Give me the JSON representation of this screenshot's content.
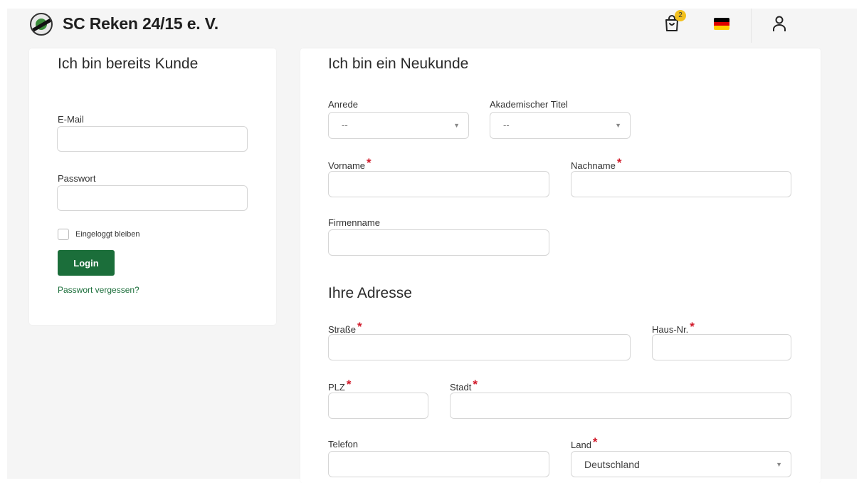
{
  "header": {
    "brand": "SC Reken 24/15 e. V.",
    "cart_count": "2",
    "logo_text": "SC Reken 24/15"
  },
  "login": {
    "title": "Ich bin bereits Kunde",
    "email_label": "E-Mail",
    "email_value": "",
    "password_label": "Passwort",
    "password_value": "",
    "remember_label": "Eingeloggt bleiben",
    "login_button": "Login",
    "forgot_link": "Passwort vergessen?"
  },
  "register": {
    "title": "Ich bin ein Neukunde",
    "salutation_label": "Anrede",
    "salutation_value": "--",
    "academic_title_label": "Akademischer Titel",
    "academic_title_value": "--",
    "first_name_label": "Vorname",
    "last_name_label": "Nachname",
    "company_label": "Firmenname",
    "address_title": "Ihre Adresse",
    "street_label": "Straße",
    "house_number_label": "Haus-Nr.",
    "zip_label": "PLZ",
    "city_label": "Stadt",
    "phone_label": "Telefon",
    "country_label": "Land",
    "country_value": "Deutschland",
    "required_marker": "*"
  },
  "colors": {
    "primary": "#1b6e3a",
    "required": "#d11a2a",
    "badge": "#f2c01e"
  },
  "icons": [
    "cart-icon",
    "flag-germany-icon",
    "user-icon",
    "chevron-down-icon"
  ]
}
